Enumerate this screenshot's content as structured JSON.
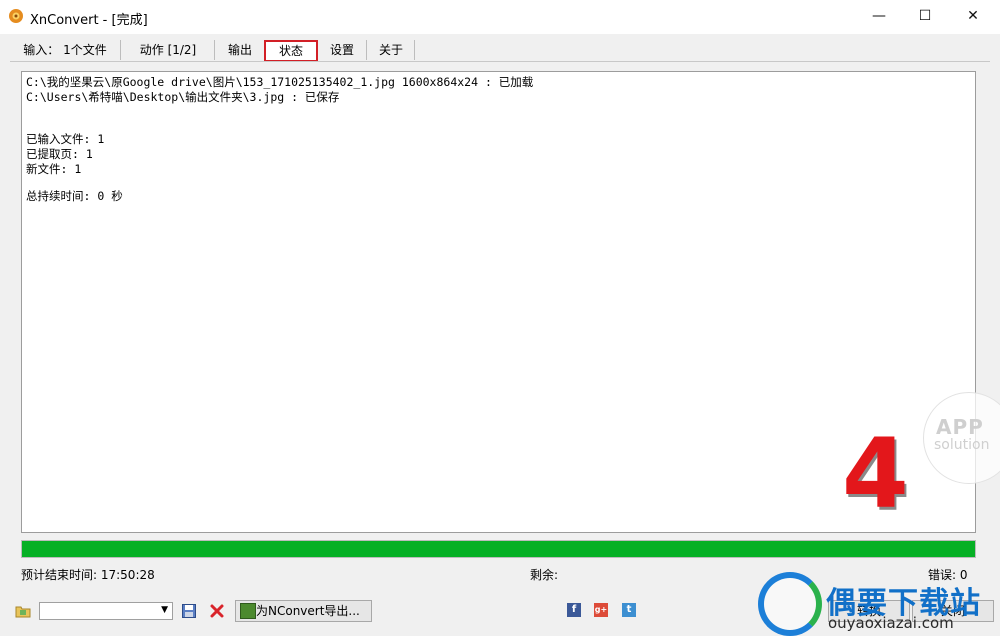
{
  "window": {
    "title": "XnConvert - [完成]"
  },
  "tabs": [
    {
      "label": "输入： 1个文件"
    },
    {
      "label": "动作 [1/2]"
    },
    {
      "label": "输出"
    },
    {
      "label": "状态"
    },
    {
      "label": "设置"
    },
    {
      "label": "关于"
    }
  ],
  "log": {
    "lines": [
      "C:\\我的坚果云\\原Google drive\\图片\\153_171025135402_1.jpg 1600x864x24 : 已加载",
      "C:\\Users\\希特喵\\Desktop\\输出文件夹\\3.jpg : 已保存",
      "已输入文件: 1",
      "已提取页: 1",
      "新文件: 1",
      "总持续时间: 0 秒"
    ]
  },
  "progress": {
    "value": 1.0,
    "color": "#06b025"
  },
  "status": {
    "eta": "预计结束时间: 17:50:28",
    "remaining": "剩余:",
    "errors": "错误: 0"
  },
  "toolbar": {
    "export_label": "为NConvert导出...",
    "convert_label": "转换",
    "close_label": "关闭"
  },
  "watermarks": {
    "step_number": "4",
    "app_logo_line1": "APP",
    "app_logo_line2": "solution",
    "site_name": "偶要下载站",
    "site_url": "ouyaoxiazai.com"
  },
  "colors": {
    "accent_red": "#d21f26",
    "progress_green": "#06b025"
  }
}
